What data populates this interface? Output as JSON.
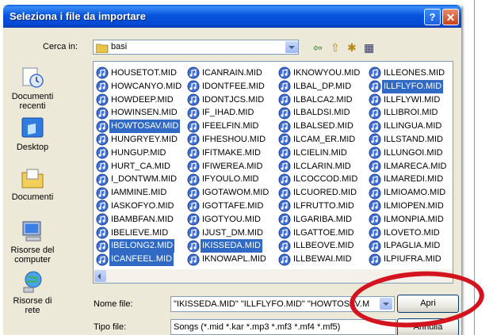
{
  "dialog": {
    "title": "Seleziona i file da importare",
    "help_glyph": "?",
    "close_glyph": "✕"
  },
  "look_in": {
    "label": "Cerca in:",
    "value": "basi"
  },
  "sidebar": {
    "items": [
      {
        "label": "Documenti recenti"
      },
      {
        "label": "Desktop"
      },
      {
        "label": "Documenti"
      },
      {
        "label": "Risorse del computer"
      },
      {
        "label": "Risorse di rete"
      }
    ]
  },
  "files": {
    "columns": [
      [
        {
          "name": "HOUSETOT.MID",
          "selected": false
        },
        {
          "name": "HOWCANYO.MID",
          "selected": false
        },
        {
          "name": "HOWDEEP.MID",
          "selected": false
        },
        {
          "name": "HOWINSEN.MID",
          "selected": false
        },
        {
          "name": "HOWTOSAV.MID",
          "selected": true
        },
        {
          "name": "HUNGRYEY.MID",
          "selected": false
        },
        {
          "name": "HUNGUP.MID",
          "selected": false
        },
        {
          "name": "HURT_CA.MID",
          "selected": false
        },
        {
          "name": "I_DONTWM.MID",
          "selected": false
        },
        {
          "name": "IAMMINE.MID",
          "selected": false
        },
        {
          "name": "IASKOFYO.MID",
          "selected": false
        },
        {
          "name": "IBAMBFAN.MID",
          "selected": false
        },
        {
          "name": "IBELIEVE.MID",
          "selected": false
        },
        {
          "name": "IBELONG2.MID",
          "selected": true
        },
        {
          "name": "ICANFEEL.MID",
          "selected": true
        }
      ],
      [
        {
          "name": "ICANRAIN.MID",
          "selected": false
        },
        {
          "name": "IDONTFEE.MID",
          "selected": false
        },
        {
          "name": "IDONTJCS.MID",
          "selected": false
        },
        {
          "name": "IF_IHAD.MID",
          "selected": false
        },
        {
          "name": "IFEELFIN.MID",
          "selected": false
        },
        {
          "name": "IFHESHOU.MID",
          "selected": false
        },
        {
          "name": "IFITMAKE.MID",
          "selected": false
        },
        {
          "name": "IFIWEREA.MID",
          "selected": false
        },
        {
          "name": "IFYOULO.MID",
          "selected": false
        },
        {
          "name": "IGOTAWOM.MID",
          "selected": false
        },
        {
          "name": "IGOTTAFE.MID",
          "selected": false
        },
        {
          "name": "IGOTYOU.MID",
          "selected": false
        },
        {
          "name": "IJUST_DM.MID",
          "selected": false
        },
        {
          "name": "IKISSEDA.MID",
          "selected": true
        },
        {
          "name": "IKNOWAPL.MID",
          "selected": false
        }
      ],
      [
        {
          "name": "IKNOWYOU.MID",
          "selected": false
        },
        {
          "name": "ILBAL_DP.MID",
          "selected": false
        },
        {
          "name": "ILBALCA2.MID",
          "selected": false
        },
        {
          "name": "ILBALDSI.MID",
          "selected": false
        },
        {
          "name": "ILBALSED.MID",
          "selected": false
        },
        {
          "name": "ILCAM_ER.MID",
          "selected": false
        },
        {
          "name": "ILCIELIN.MID",
          "selected": false
        },
        {
          "name": "ILCLARIN.MID",
          "selected": false
        },
        {
          "name": "ILCOCCOD.MID",
          "selected": false
        },
        {
          "name": "ILCUORED.MID",
          "selected": false
        },
        {
          "name": "ILFRUTTO.MID",
          "selected": false
        },
        {
          "name": "ILGARIBA.MID",
          "selected": false
        },
        {
          "name": "ILGATTOE.MID",
          "selected": false
        },
        {
          "name": "ILLBEOVE.MID",
          "selected": false
        },
        {
          "name": "ILLBEWAI.MID",
          "selected": false
        }
      ],
      [
        {
          "name": "ILLEONES.MID",
          "selected": false
        },
        {
          "name": "ILLFLYFO.MID",
          "selected": true
        },
        {
          "name": "ILLFLYWI.MID",
          "selected": false
        },
        {
          "name": "ILLIBROI.MID",
          "selected": false
        },
        {
          "name": "ILLINGUA.MID",
          "selected": false
        },
        {
          "name": "ILLSTAND.MID",
          "selected": false
        },
        {
          "name": "ILLUNGOI.MID",
          "selected": false
        },
        {
          "name": "ILMARECA.MID",
          "selected": false
        },
        {
          "name": "ILMAREDI.MID",
          "selected": false
        },
        {
          "name": "ILMIOAMO.MID",
          "selected": false
        },
        {
          "name": "ILMIOPEN.MID",
          "selected": false
        },
        {
          "name": "ILMONPIA.MID",
          "selected": false
        },
        {
          "name": "ILOVETO.MID",
          "selected": false
        },
        {
          "name": "ILPAGLIA.MID",
          "selected": false
        },
        {
          "name": "ILPIUFRA.MID",
          "selected": false
        }
      ]
    ]
  },
  "filename": {
    "label": "Nome file:",
    "value": "\"IKISSEDA.MID\" \"ILLFLYFO.MID\" \"HOWTOSAV.M"
  },
  "filetype": {
    "label": "Tipo file:",
    "value": "Songs (*.mid *.kar *.mp3 *.mf3 *.mf4 *.mf5)"
  },
  "buttons": {
    "open": "Apri",
    "cancel": "Annulla"
  },
  "toolbar": {
    "back_glyph": "⇦",
    "up_glyph": "⇧",
    "new_folder_glyph": "✱",
    "view_glyph": "▦"
  },
  "colors": {
    "selection": "#316ac5",
    "annotation": "#d3141e",
    "titlebar": "#0855dd"
  }
}
